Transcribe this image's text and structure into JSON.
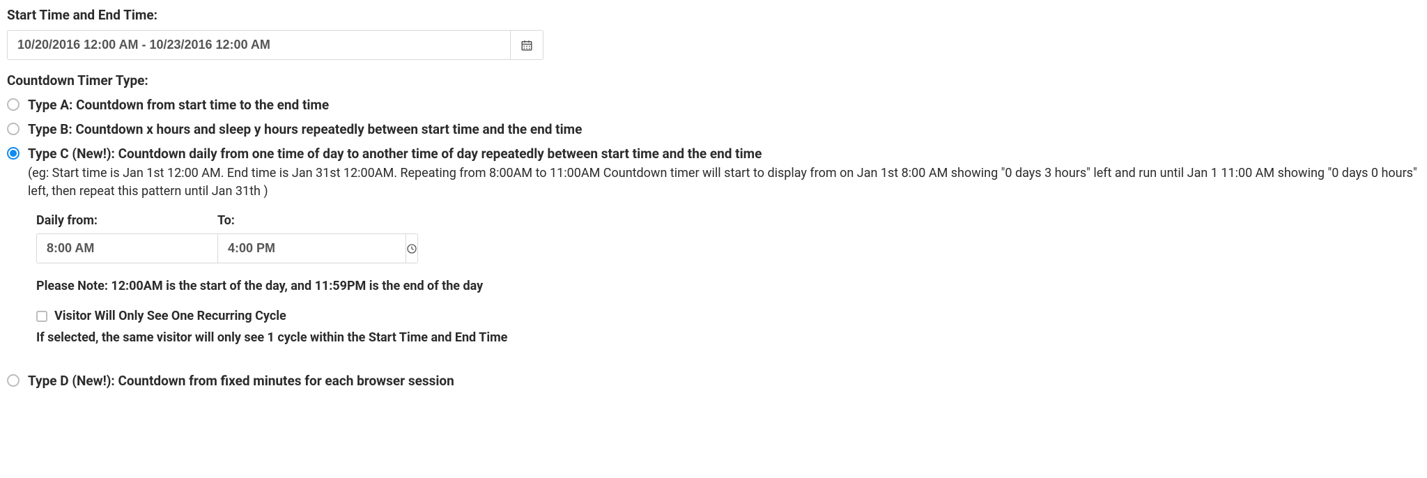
{
  "labels": {
    "start_end": "Start Time and End Time:",
    "timer_type": "Countdown Timer Type:"
  },
  "datetime_range": {
    "value": "10/20/2016 12:00 AM - 10/23/2016 12:00 AM"
  },
  "options": {
    "a": {
      "label": "Type A: Countdown from start time to the end time",
      "selected": false
    },
    "b": {
      "label": "Type B: Countdown x hours and sleep y hours repeatedly between start time and the end time",
      "selected": false
    },
    "c": {
      "label": "Type C (New!): Countdown daily from one time of day to another time of day repeatedly between start time and the end time",
      "selected": true,
      "example": "(eg: Start time is Jan 1st 12:00 AM. End time is Jan 31st 12:00AM. Repeating from 8:00AM to 11:00AM Countdown timer will start to display from on Jan 1st 8:00 AM showing \"0 days 3 hours\" left and run until Jan 1 11:00 AM showing \"0 days 0 hours\" left, then repeat this pattern until Jan 31th )",
      "daily_from_label": "Daily from:",
      "daily_to_label": "To:",
      "daily_from_value": "8:00 AM",
      "daily_to_value": "4:00 PM",
      "note": "Please Note: 12:00AM is the start of the day, and 11:59PM is the end of the day",
      "checkbox_label": "Visitor Will Only See One Recurring Cycle",
      "checkbox_checked": false,
      "checkbox_help": "If selected, the same visitor will only see 1 cycle within the Start Time and End Time"
    },
    "d": {
      "label": "Type D (New!): Countdown from fixed minutes for each browser session",
      "selected": false
    }
  }
}
